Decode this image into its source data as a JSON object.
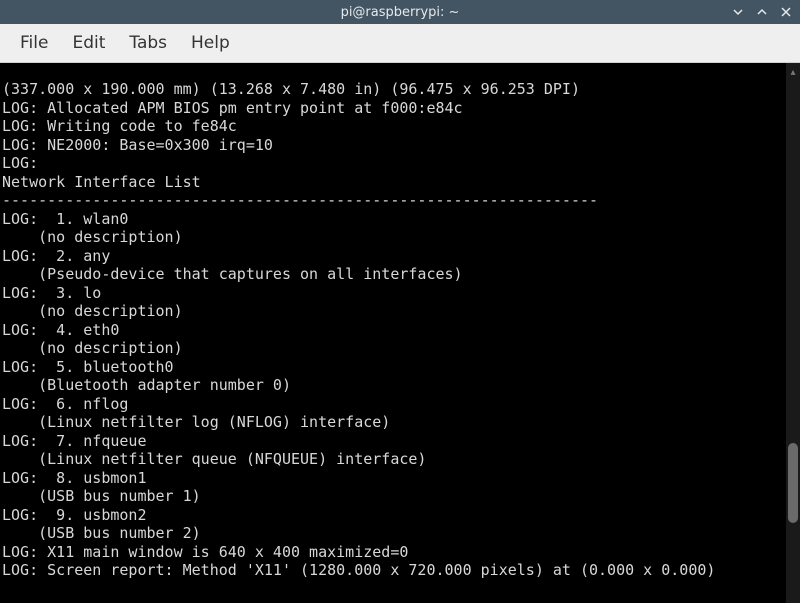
{
  "window": {
    "title": "pi@raspberrypi: ~"
  },
  "menu": {
    "file": "File",
    "edit": "Edit",
    "tabs": "Tabs",
    "help": "Help"
  },
  "terminal": {
    "lines": [
      "(337.000 x 190.000 mm) (13.268 x 7.480 in) (96.475 x 96.253 DPI)",
      "LOG: Allocated APM BIOS pm entry point at f000:e84c",
      "LOG: Writing code to fe84c",
      "LOG: NE2000: Base=0x300 irq=10",
      "LOG:",
      "Network Interface List",
      "------------------------------------------------------------------",
      "LOG:  1. wlan0",
      "    (no description)",
      "LOG:  2. any",
      "    (Pseudo-device that captures on all interfaces)",
      "LOG:  3. lo",
      "    (no description)",
      "LOG:  4. eth0",
      "    (no description)",
      "LOG:  5. bluetooth0",
      "    (Bluetooth adapter number 0)",
      "LOG:  6. nflog",
      "    (Linux netfilter log (NFLOG) interface)",
      "LOG:  7. nfqueue",
      "    (Linux netfilter queue (NFQUEUE) interface)",
      "LOG:  8. usbmon1",
      "    (USB bus number 1)",
      "LOG:  9. usbmon2",
      "    (USB bus number 2)",
      "LOG: X11 main window is 640 x 400 maximized=0",
      "LOG: Screen report: Method 'X11' (1280.000 x 720.000 pixels) at (0.000 x 0.000)"
    ]
  }
}
